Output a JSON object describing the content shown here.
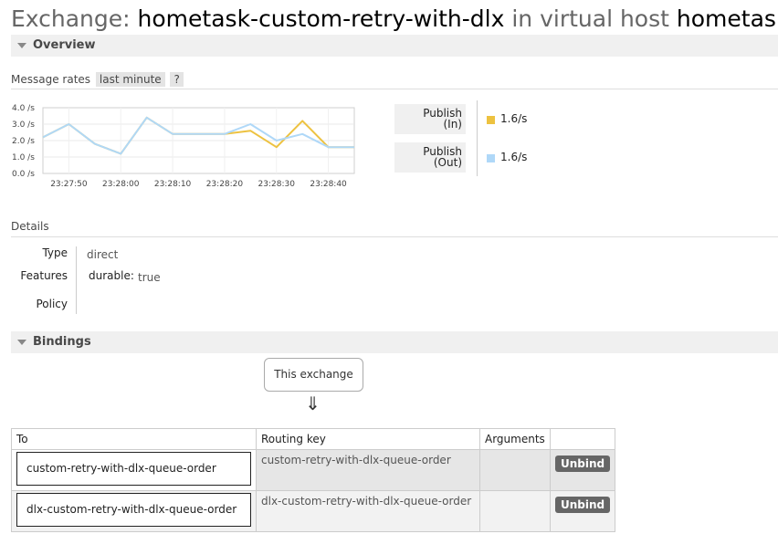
{
  "page_title": {
    "prefix": "Exchange:",
    "exchange_name": "hometask-custom-retry-with-dlx",
    "mid": "in virtual host",
    "vhost": "hometask"
  },
  "overview": {
    "label": "Overview",
    "message_rates_label": "Message rates",
    "range_option": "last minute",
    "help": "?",
    "chart_data": {
      "type": "line",
      "x": [
        "23:27:45",
        "23:27:50",
        "23:27:55",
        "23:28:00",
        "23:28:05",
        "23:28:10",
        "23:28:15",
        "23:28:20",
        "23:28:25",
        "23:28:30",
        "23:28:35",
        "23:28:40",
        "23:28:43"
      ],
      "x_tick_labels": [
        "23:27:50",
        "23:28:00",
        "23:28:10",
        "23:28:20",
        "23:28:30",
        "23:28:40"
      ],
      "y_tick_labels": [
        "4.0 /s",
        "3.0 /s",
        "2.0 /s",
        "1.0 /s",
        "0.0 /s"
      ],
      "ylim": [
        0,
        4
      ],
      "grid": true,
      "series": [
        {
          "name": "Publish (In)",
          "color": "#edc240",
          "values": [
            2.2,
            3.0,
            1.8,
            1.2,
            3.4,
            2.4,
            2.4,
            2.4,
            2.6,
            1.6,
            3.2,
            1.6,
            1.6
          ]
        },
        {
          "name": "Publish (Out)",
          "color": "#afd8f8",
          "values": [
            2.2,
            3.0,
            1.8,
            1.2,
            3.4,
            2.4,
            2.4,
            2.4,
            3.0,
            2.0,
            2.4,
            1.6,
            1.6
          ]
        }
      ]
    },
    "legend": [
      {
        "label_line1": "Publish",
        "label_line2": "(In)",
        "value": "1.6/s",
        "color": "#edc240"
      },
      {
        "label_line1": "Publish",
        "label_line2": "(Out)",
        "value": "1.6/s",
        "color": "#afd8f8"
      }
    ]
  },
  "details": {
    "label": "Details",
    "type_label": "Type",
    "type_value": "direct",
    "features_label": "Features",
    "durable_key": "durable:",
    "durable_value": "true",
    "policy_label": "Policy"
  },
  "bindings": {
    "label": "Bindings",
    "this_exchange": "This exchange",
    "arrow": "⇓",
    "columns": [
      "To",
      "Routing key",
      "Arguments"
    ],
    "rows": [
      {
        "to": "custom-retry-with-dlx-queue-order",
        "routing_key": "custom-retry-with-dlx-queue-order",
        "arguments": "",
        "action": "Unbind"
      },
      {
        "to": "dlx-custom-retry-with-dlx-queue-order",
        "routing_key": "dlx-custom-retry-with-dlx-queue-order",
        "arguments": "",
        "action": "Unbind"
      }
    ]
  }
}
